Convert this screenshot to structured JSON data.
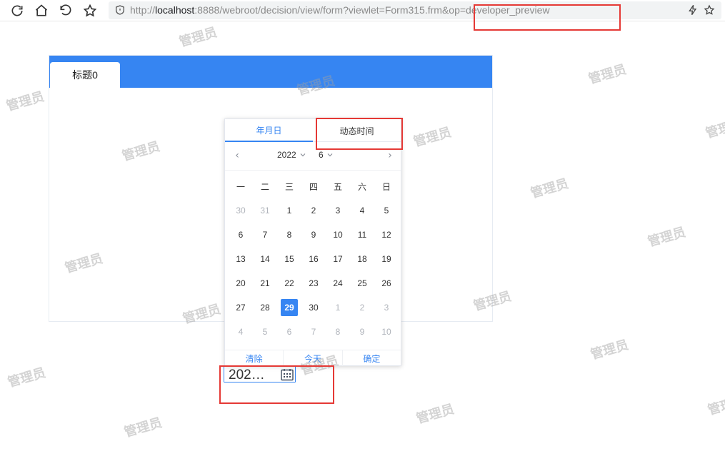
{
  "browser": {
    "url_prefix": "http://",
    "url_host": "localhost",
    "url_rest": ":8888/webroot/decision/view/form?viewlet=Form315.frm&op=developer_preview"
  },
  "watermark_text": "管理员",
  "panel": {
    "tab_label": "标题0",
    "header_color": "#3685f2"
  },
  "picker": {
    "tabs": [
      "年月日",
      "动态时间"
    ],
    "active_tab": "年月日",
    "year": "2022",
    "month": "6",
    "weekdays": [
      "一",
      "二",
      "三",
      "四",
      "五",
      "六",
      "日"
    ],
    "weeks": [
      [
        "30",
        "31",
        "1",
        "2",
        "3",
        "4",
        "5"
      ],
      [
        "6",
        "7",
        "8",
        "9",
        "10",
        "11",
        "12"
      ],
      [
        "13",
        "14",
        "15",
        "16",
        "17",
        "18",
        "19"
      ],
      [
        "20",
        "21",
        "22",
        "23",
        "24",
        "25",
        "26"
      ],
      [
        "27",
        "28",
        "29",
        "30",
        "1",
        "2",
        "3"
      ],
      [
        "4",
        "5",
        "6",
        "7",
        "8",
        "9",
        "10"
      ]
    ],
    "selected_day": "29",
    "footer": {
      "clear": "清除",
      "today": "今天",
      "confirm": "确定"
    }
  },
  "date_input": {
    "value": "202…"
  },
  "colors": {
    "accent": "#3685f2",
    "annotation_red": "#e53935"
  }
}
